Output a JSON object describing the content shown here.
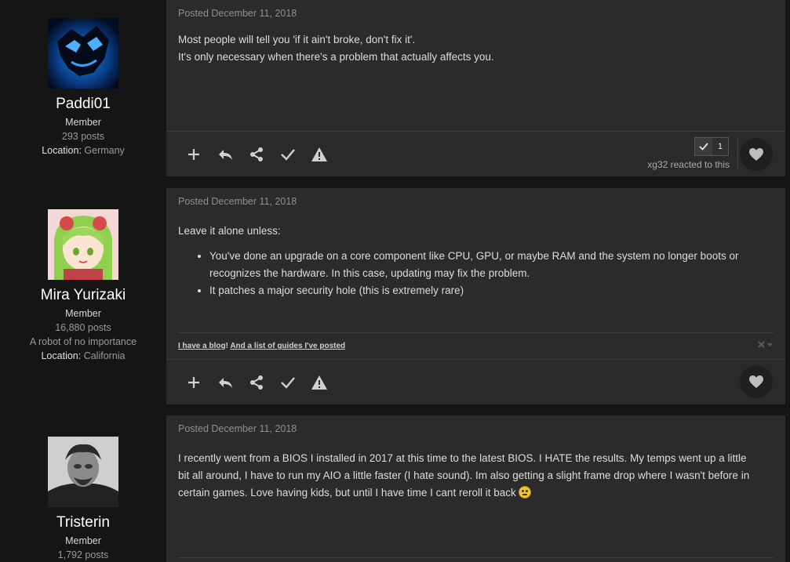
{
  "posts": [
    {
      "author": {
        "name": "Paddi01",
        "title": "Member",
        "posts": "293 posts",
        "location_label": "Location:",
        "location": "Germany"
      },
      "date": "Posted December 11, 2018",
      "body": [
        "Most people will tell you 'if it ain't broke, don't fix it'.",
        "It's only necessary when there's a problem that actually affects you."
      ],
      "reaction_count": "1",
      "reacted_text": "xg32 reacted to this"
    },
    {
      "author": {
        "name": "Mira Yurizaki",
        "title": "Member",
        "posts": "16,880 posts",
        "custom_title": "A robot of no importance",
        "location_label": "Location:",
        "location": "California"
      },
      "date": "Posted December 11, 2018",
      "intro": "Leave it alone unless:",
      "bullets": [
        "You've done an upgrade on a core component like CPU, GPU, or maybe RAM and the system no longer boots or recognizes the hardware. In this case, updating may fix the problem.",
        "It patches a major security hole (this is extremely rare)"
      ],
      "signature": {
        "link1": "I have a blog",
        "sep": "! ",
        "link2": "And a list of guides I've posted"
      }
    },
    {
      "author": {
        "name": "Tristerin",
        "title": "Member",
        "posts": "1,792 posts"
      },
      "date": "Posted December 11, 2018",
      "body": "I recently went from a BIOS I installed in 2017 at this time to the latest BIOS.  I HATE the results.  My temps went up a little bit all around, I have to run my AIO a little faster (I hate sound).  Im also getting a slight frame drop where I wasn't before in certain games.  Love having kids, but until I have time I cant reroll it back"
    }
  ],
  "icons": [
    "plus-icon",
    "reply-icon",
    "share-icon",
    "check-icon",
    "warning-icon",
    "heart-icon",
    "close-icon",
    "chevron-down-icon"
  ],
  "colors": {
    "background": "#151515",
    "post_bg": "#2b2b2b",
    "text": "#dcdcdc",
    "muted": "#8f8f8f"
  }
}
